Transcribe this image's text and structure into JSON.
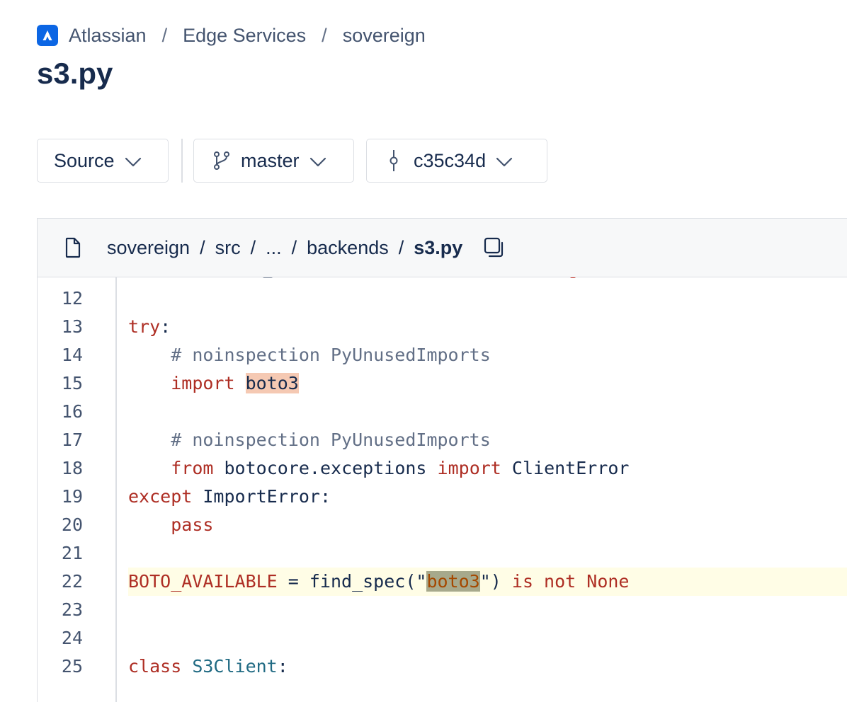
{
  "breadcrumb": {
    "items": [
      "Atlassian",
      "Edge Services",
      "sovereign"
    ],
    "separator": "/"
  },
  "page_title": "s3.py",
  "selectors": {
    "source": "Source",
    "branch": "master",
    "commit": "c35c34d"
  },
  "file_path": {
    "parts": [
      "sovereign",
      "src",
      "...",
      "backends"
    ],
    "current": "s3.py",
    "separator": "/"
  },
  "code": {
    "line_numbers": [
      "12",
      "13",
      "14",
      "15",
      "16",
      "17",
      "18",
      "19",
      "20",
      "21",
      "22",
      "23",
      "24",
      "25"
    ],
    "tokens": {
      "try": "try",
      "colon": ":",
      "comment_noinspection": "# noinspection PyUnusedImports",
      "import": "import",
      "boto3": "boto3",
      "from": "from",
      "botocore_exceptions": "botocore.exceptions",
      "ClientError": "ClientError",
      "except": "except",
      "ImportError": "ImportError",
      "pass": "pass",
      "BOTO_AVAILABLE": "BOTO_AVAILABLE",
      "assign": " = ",
      "find_spec": "find_spec",
      "open_paren_quote": "(\"",
      "close_quote_paren": "\")",
      "is_not": "is not",
      "None": "None",
      "class": "class",
      "S3Client": "S3Client"
    },
    "highlighted_line": "22"
  },
  "colors": {
    "accent": "#0c66e4",
    "keyword": "#ae2e24",
    "comment": "#626f86",
    "class_name": "#206a83",
    "highlight": "#fffde6",
    "match": "#f5c9b3"
  }
}
